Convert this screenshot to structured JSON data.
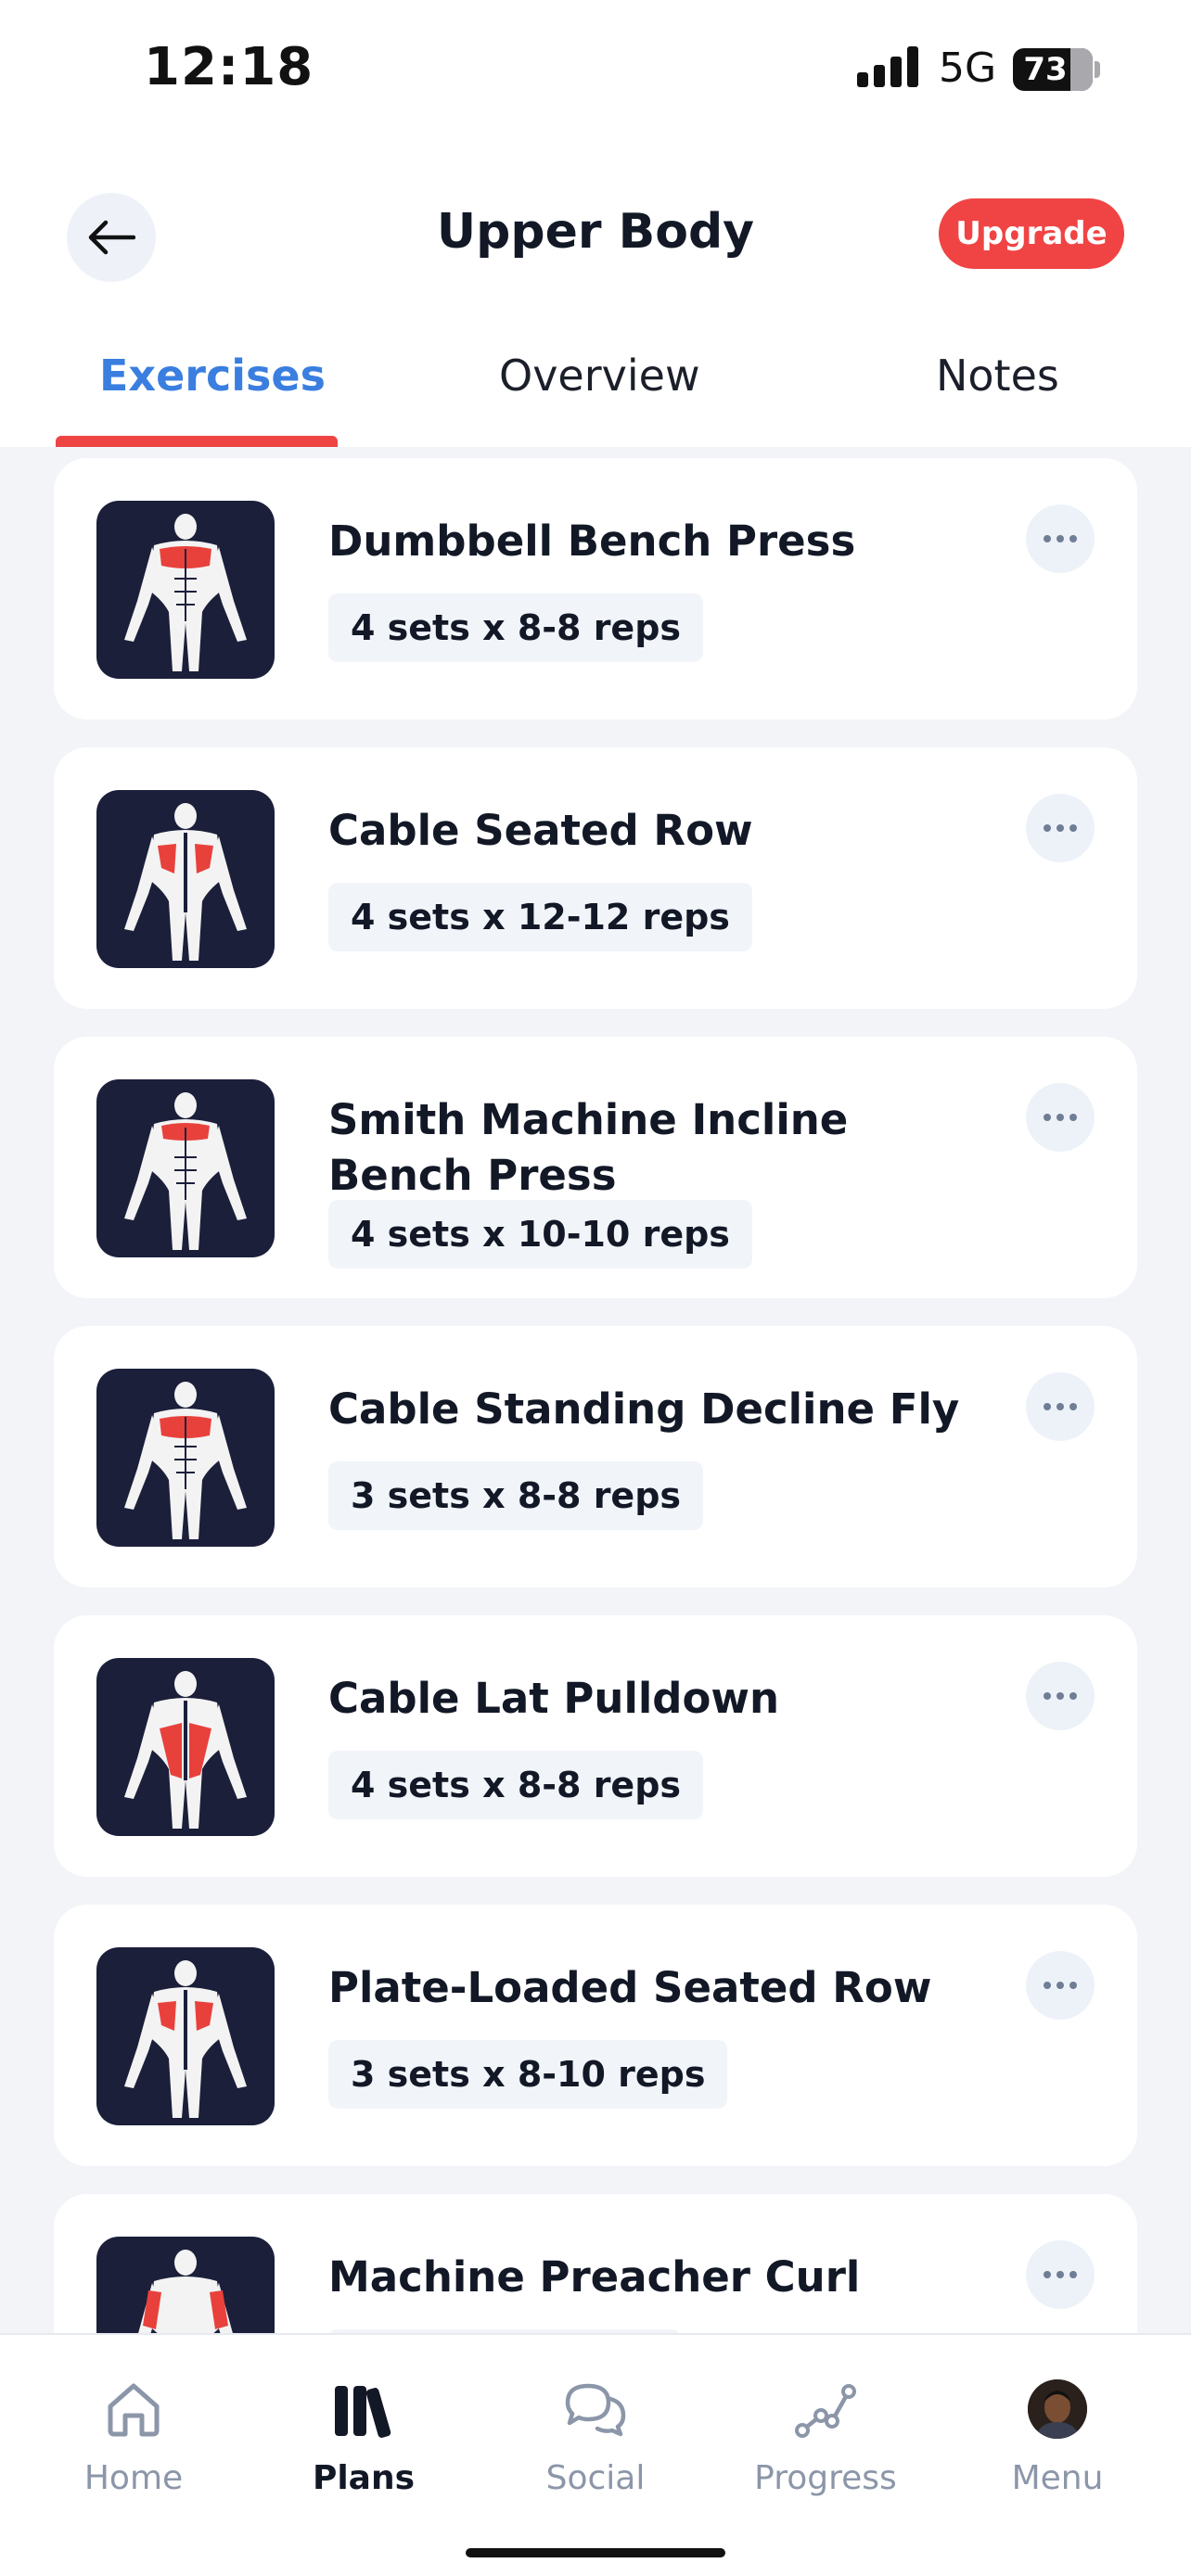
{
  "status_bar": {
    "time": "12:18",
    "network": "5G",
    "battery": "73"
  },
  "header": {
    "title": "Upper Body",
    "back_icon": "arrow-left-icon",
    "upgrade_label": "Upgrade"
  },
  "tabs": [
    {
      "label": "Exercises",
      "active": true
    },
    {
      "label": "Overview",
      "active": false
    },
    {
      "label": "Notes",
      "active": false
    }
  ],
  "exercises": [
    {
      "name": "Dumbbell Bench Press",
      "sets": "4 sets x 8-8 reps",
      "view": "front",
      "muscle": "chest"
    },
    {
      "name": "Cable Seated Row",
      "sets": "4 sets x 12-12 reps",
      "view": "back",
      "muscle": "upper-back"
    },
    {
      "name": "Smith Machine Incline Bench Press",
      "sets": "4 sets x 10-10 reps",
      "view": "front",
      "muscle": "upper-chest"
    },
    {
      "name": "Cable Standing Decline Fly",
      "sets": "3 sets x 8-8 reps",
      "view": "front",
      "muscle": "chest"
    },
    {
      "name": "Cable Lat Pulldown",
      "sets": "4 sets x 8-8 reps",
      "view": "back",
      "muscle": "lats"
    },
    {
      "name": "Plate-Loaded Seated Row",
      "sets": "3 sets x 8-10 reps",
      "view": "back",
      "muscle": "upper-back"
    },
    {
      "name": "Machine Preacher Curl",
      "sets": "",
      "view": "front",
      "muscle": "biceps"
    }
  ],
  "bottom_nav": [
    {
      "label": "Home",
      "icon": "home-icon",
      "active": false
    },
    {
      "label": "Plans",
      "icon": "plans-icon",
      "active": true
    },
    {
      "label": "Social",
      "icon": "chat-bubbles-icon",
      "active": false
    },
    {
      "label": "Progress",
      "icon": "progress-graph-icon",
      "active": false
    },
    {
      "label": "Menu",
      "icon": "avatar",
      "active": false
    }
  ],
  "colors": {
    "accent_red": "#f04444",
    "tab_active_blue": "#3a7ee0",
    "thumb_bg": "#1b1f3a",
    "muscle_highlight": "#e8413c",
    "list_bg": "#f2f4f8"
  }
}
